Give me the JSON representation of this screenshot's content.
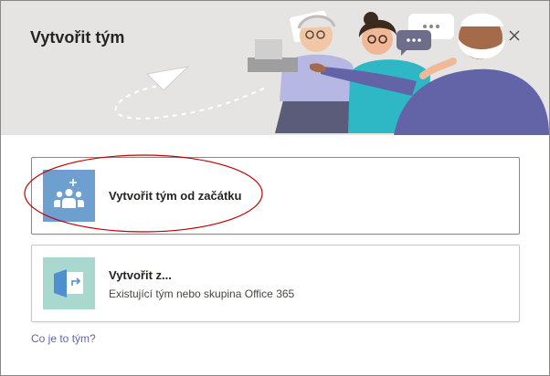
{
  "dialog": {
    "title": "Vytvořit tým",
    "close_icon": "close-icon"
  },
  "options": [
    {
      "title": "Vytvořit tým od začátku",
      "subtitle": "",
      "icon": "team-add-icon",
      "accent": "#6d9fcf"
    },
    {
      "title": "Vytvořit z...",
      "subtitle": "Existující tým nebo skupina Office 365",
      "icon": "team-import-icon",
      "accent": "#a9d8cf"
    }
  ],
  "footer": {
    "help_link": "Co je to tým?"
  },
  "colors": {
    "header_bg": "#e6e4e3",
    "link": "#6264a7",
    "annotation": "#c00000"
  }
}
